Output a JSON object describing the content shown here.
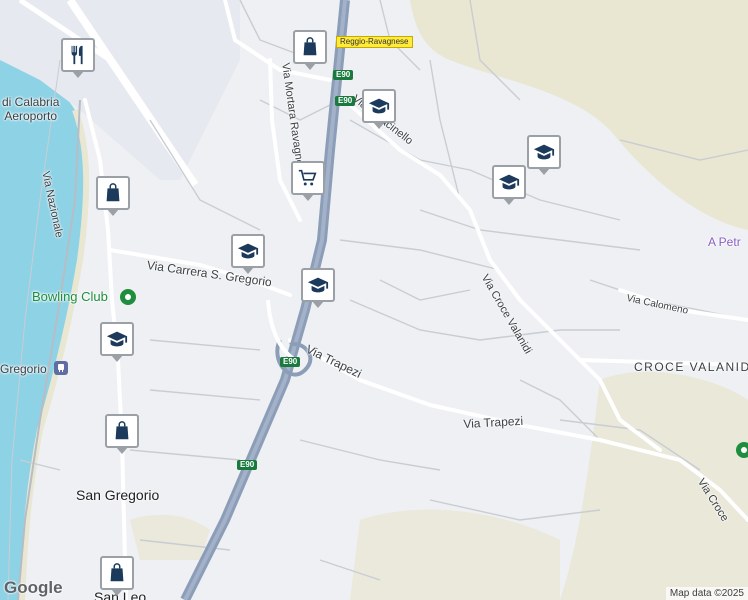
{
  "map": {
    "colors": {
      "water": "#8ed2e6",
      "land": "#eef0f3",
      "park": "#e9e6d2",
      "motorway": "#8c9db8",
      "road": "#ffffff",
      "minor": "#c9cdd2"
    },
    "labels": {
      "airport": "di Calabria\nAeroporto",
      "airport_line1": "di Calabria",
      "airport_line2": "Aeroporto",
      "via_nazionale": "Via Nazionale",
      "via_mortara": "Via Mortara Ravagnese",
      "via_saracinello": "Via Saracinello",
      "via_carrera": "Via Carrera S. Gregorio",
      "bowling": "Bowling Club",
      "gregorio_station": "Gregorio",
      "via_trapezi_1": "Via Trapezi",
      "via_trapezi_2": "Via Trapezi",
      "via_croce_valanidi": "Via Croce Valanidi",
      "via_calomeno": "Via Calomeno",
      "croce_valanidi": "CROCE VALANIDI",
      "a_petr": "A Petr",
      "san_gregorio": "San Gregorio",
      "san_leo": "San Leo",
      "via_croce": "Via Croce",
      "reggio_ravagnese": "Reggio-Ravagnese",
      "e90_a": "E90",
      "e90_b": "E90",
      "e90_c": "E90",
      "e90_d": "E90"
    },
    "pins": [
      {
        "icon": "restaurant-icon"
      },
      {
        "icon": "shopping-bag-icon"
      },
      {
        "icon": "shopping-bag-icon"
      },
      {
        "icon": "shopping-cart-icon"
      },
      {
        "icon": "school-icon"
      },
      {
        "icon": "school-icon"
      },
      {
        "icon": "school-icon"
      },
      {
        "icon": "school-icon"
      },
      {
        "icon": "school-icon"
      },
      {
        "icon": "school-icon"
      },
      {
        "icon": "shopping-bag-icon"
      },
      {
        "icon": "shopping-bag-icon"
      }
    ],
    "attribution": "Map data ©2025",
    "google_logo": "Google"
  }
}
